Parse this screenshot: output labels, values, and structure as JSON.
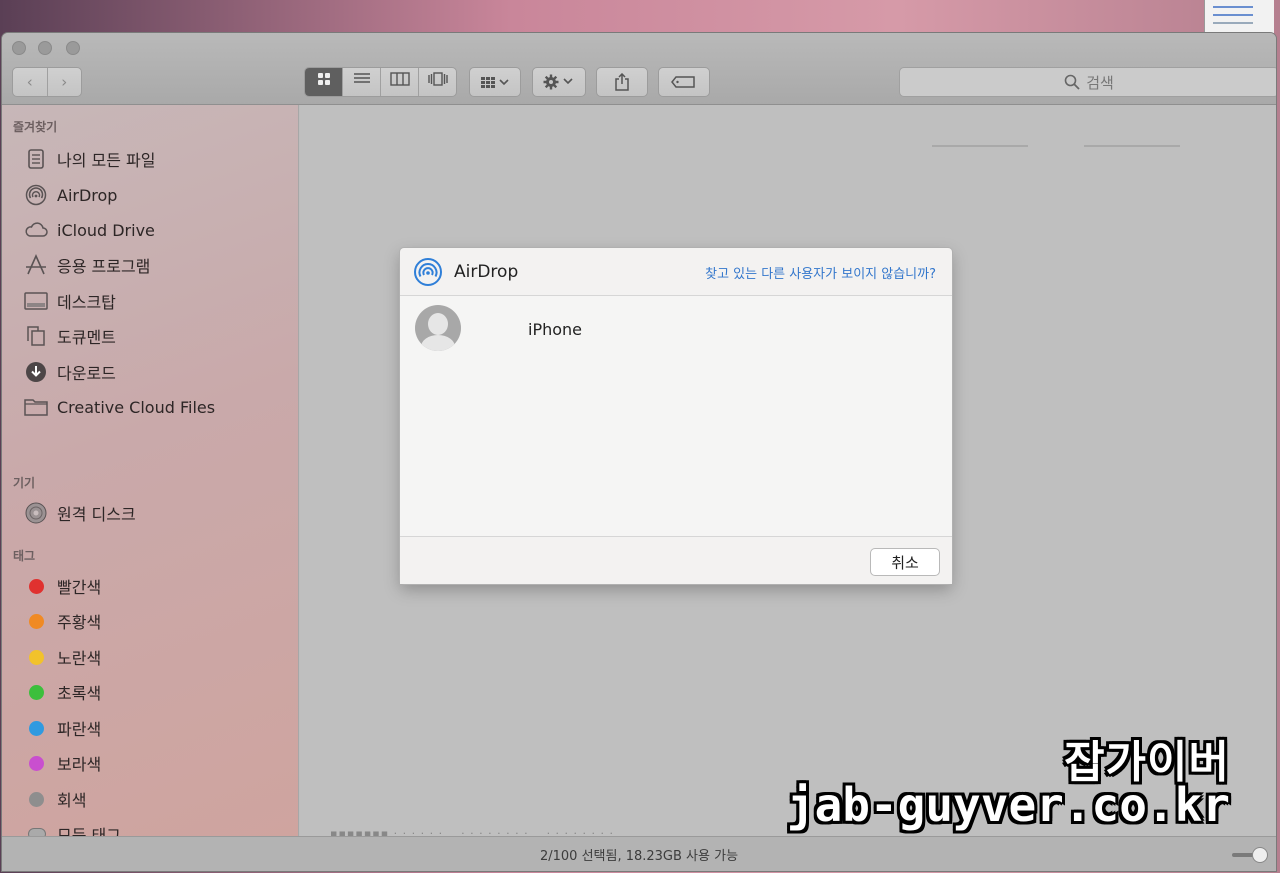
{
  "toolbar": {
    "back_icon": "chevron-left-icon",
    "forward_icon": "chevron-right-icon",
    "search_placeholder": "검색"
  },
  "sidebar": {
    "favorites_header": "즐겨찾기",
    "favorites": [
      {
        "label": "나의 모든 파일",
        "icon": "all-files-icon"
      },
      {
        "label": "AirDrop",
        "icon": "airdrop-icon"
      },
      {
        "label": "iCloud Drive",
        "icon": "cloud-icon"
      },
      {
        "label": "응용 프로그램",
        "icon": "applications-icon"
      },
      {
        "label": "데스크탑",
        "icon": "desktop-icon"
      },
      {
        "label": "도큐멘트",
        "icon": "document-icon"
      },
      {
        "label": "다운로드",
        "icon": "download-icon"
      },
      {
        "label": "Creative Cloud Files",
        "icon": "folder-icon"
      }
    ],
    "devices_header": "기기",
    "devices": [
      {
        "label": "원격 디스크",
        "icon": "disc-icon"
      }
    ],
    "tags_header": "태그",
    "tags": [
      {
        "label": "빨간색",
        "color": "#e0312f"
      },
      {
        "label": "주황색",
        "color": "#f08a24"
      },
      {
        "label": "노란색",
        "color": "#f2c22b"
      },
      {
        "label": "초록색",
        "color": "#3cbf3c"
      },
      {
        "label": "파란색",
        "color": "#2f9ae0"
      },
      {
        "label": "보라색",
        "color": "#c94fcf"
      },
      {
        "label": "회색",
        "color": "#8e8e8e"
      },
      {
        "label": "모든 태그..."
      }
    ]
  },
  "statusbar": {
    "text": "2/100 선택됨, 18.23GB 사용 가능"
  },
  "dialog": {
    "title": "AirDrop",
    "help_link": "찾고 있는 다른 사용자가 보이지 않습니까?",
    "device_name": "iPhone",
    "cancel_label": "취소"
  },
  "watermark": {
    "korean": "잡가이버",
    "url": "jab-guyver.co.kr"
  }
}
